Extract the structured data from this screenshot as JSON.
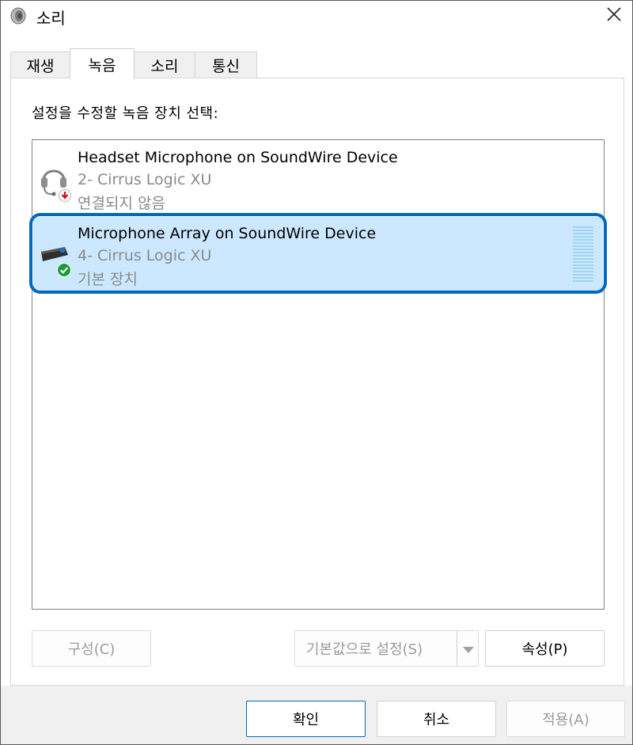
{
  "window": {
    "title": "소리"
  },
  "tabs": [
    {
      "label": "재생",
      "active": false
    },
    {
      "label": "녹음",
      "active": true
    },
    {
      "label": "소리",
      "active": false
    },
    {
      "label": "통신",
      "active": false
    }
  ],
  "recording": {
    "instruction": "설정을 수정할 녹음 장치 선택:",
    "devices": [
      {
        "name": "Headset Microphone on SoundWire Device",
        "driver": "2- Cirrus Logic XU",
        "status": "연결되지 않음",
        "icon": "headset-icon",
        "status_icon": "disconnected-badge-icon",
        "selected": false
      },
      {
        "name": "Microphone Array on SoundWire Device",
        "driver": "4- Cirrus Logic XU",
        "status": "기본 장치",
        "icon": "microphone-array-icon",
        "status_icon": "default-check-badge-icon",
        "selected": true,
        "level": 0
      }
    ],
    "buttons": {
      "configure": "구성(C)",
      "set_default": "기본값으로 설정(S)",
      "properties": "속성(P)"
    }
  },
  "footer": {
    "ok": "확인",
    "cancel": "취소",
    "apply": "적용(A)"
  },
  "colors": {
    "accent": "#0067c0",
    "selection": "#cce8ff",
    "meter": "#9fd6ef"
  }
}
